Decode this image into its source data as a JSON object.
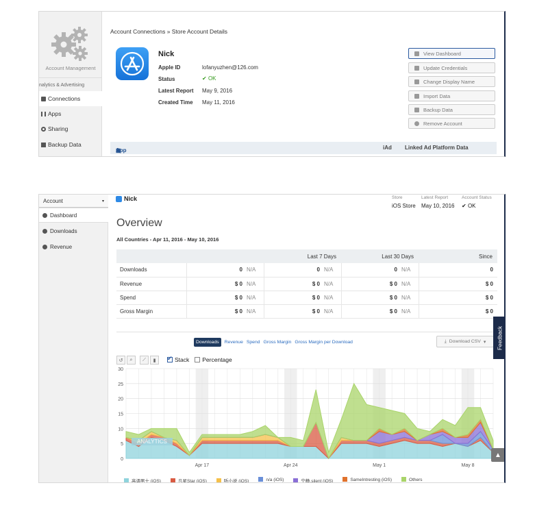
{
  "top_panel": {
    "sidebar": {
      "account_management": "Account Management",
      "section_label": "nalytics & Advertising",
      "items": [
        {
          "label": "Connections",
          "active": true
        },
        {
          "label": "Apps"
        },
        {
          "label": "Sharing"
        },
        {
          "label": "Backup Data"
        }
      ]
    },
    "breadcrumb": "Account Connections » Store Account Details",
    "account": {
      "name": "Nick",
      "fields": [
        {
          "label": "Apple ID",
          "value": "lofanyuzhen@126.com"
        },
        {
          "label": "Status",
          "value": "OK"
        },
        {
          "label": "Latest Report",
          "value": "May 9, 2016"
        },
        {
          "label": "Created Time",
          "value": "May 11, 2016"
        }
      ]
    },
    "actions": [
      "View Dashboard",
      "Update Credentials",
      "Change Display Name",
      "Import Data",
      "Backup Data",
      "Remove Account"
    ],
    "table_header": {
      "app": "App",
      "iad": "iAd",
      "linked": "Linked Ad Platform Data"
    }
  },
  "bottom_panel": {
    "sidebar": {
      "account_dropdown": "Account",
      "items": [
        {
          "label": "Dashboard",
          "active": true
        },
        {
          "label": "Downloads"
        },
        {
          "label": "Revenue"
        }
      ]
    },
    "header": {
      "name": "Nick",
      "store_label": "Store",
      "store_value": "iOS Store",
      "latest_report_label": "Latest Report",
      "latest_report_value": "May 10, 2016",
      "status_label": "Account Status",
      "status_value": "OK"
    },
    "overview": {
      "title": "Overview",
      "subtitle": "All Countries - Apr 11, 2016 - May 10, 2016",
      "columns": [
        "Last 7 Days",
        "Last 30 Days",
        "Since"
      ],
      "rows": [
        {
          "label": "Downloads",
          "c1": "0",
          "c1na": "N/A",
          "c2": "0",
          "c2na": "N/A",
          "c3": "0",
          "c3na": "N/A",
          "since": "0"
        },
        {
          "label": "Revenue",
          "c1": "$ 0",
          "c1na": "N/A",
          "c2": "$ 0",
          "c2na": "N/A",
          "c3": "$ 0",
          "c3na": "N/A",
          "since": "$ 0"
        },
        {
          "label": "Spend",
          "c1": "$ 0",
          "c1na": "N/A",
          "c2": "$ 0",
          "c2na": "N/A",
          "c3": "$ 0",
          "c3na": "N/A",
          "since": "$ 0"
        },
        {
          "label": "Gross Margin",
          "c1": "$ 0",
          "c1na": "N/A",
          "c2": "$ 0",
          "c2na": "N/A",
          "c3": "$ 0",
          "c3na": "N/A",
          "since": "$ 0"
        }
      ]
    },
    "chart_tabs": [
      "Downloads",
      "Revenue",
      "Spend",
      "Gross Margin",
      "Gross Margin per Download"
    ],
    "download_csv": "Download CSV",
    "feedback": "Feedback",
    "options": {
      "stack": "Stack",
      "percentage": "Percentage"
    },
    "watermark": "ANALYTICS"
  },
  "chart_data": {
    "type": "area",
    "stacked": true,
    "ylim": [
      0,
      30
    ],
    "yticks": [
      0,
      5,
      10,
      15,
      20,
      25,
      30
    ],
    "xtick_labels": [
      "Apr 17",
      "Apr 24",
      "May 1",
      "May 8"
    ],
    "x": [
      "Apr 11",
      "Apr 12",
      "Apr 13",
      "Apr 14",
      "Apr 15",
      "Apr 16",
      "Apr 17",
      "Apr 18",
      "Apr 19",
      "Apr 20",
      "Apr 21",
      "Apr 22",
      "Apr 23",
      "Apr 24",
      "Apr 25",
      "Apr 26",
      "Apr 27",
      "Apr 28",
      "Apr 29",
      "Apr 30",
      "May 1",
      "May 2",
      "May 3",
      "May 4",
      "May 5",
      "May 6",
      "May 7",
      "May 8",
      "May 9",
      "May 10"
    ],
    "series": [
      {
        "name": "高调男士 (iOS)",
        "color": "#8fd3dc",
        "values": [
          6,
          4,
          7,
          6,
          4,
          1,
          5,
          5,
          5,
          5,
          5,
          5,
          5,
          4,
          4,
          4,
          0,
          5,
          5,
          5,
          4,
          5,
          6,
          5,
          5,
          4,
          5,
          4,
          6,
          2
        ]
      },
      {
        "name": "凡星Star (iOS)",
        "color": "#d95b43",
        "values": [
          1,
          1,
          1,
          1,
          1,
          0,
          1,
          1,
          1,
          1,
          1,
          1,
          1,
          0,
          0,
          8,
          0,
          1,
          1,
          1,
          1,
          1,
          1,
          1,
          1,
          1,
          0,
          0,
          1,
          0
        ]
      },
      {
        "name": "听小说 (iOS)",
        "color": "#f5c04a",
        "values": [
          0,
          1,
          1,
          0,
          1,
          0,
          1,
          1,
          1,
          1,
          1,
          2,
          1,
          0,
          0,
          0,
          0,
          1,
          0,
          0,
          0,
          0,
          0,
          0,
          0,
          0,
          0,
          0,
          0,
          0
        ]
      },
      {
        "name": "n/a (iOS)",
        "color": "#6a8fd8",
        "values": [
          0,
          0,
          0,
          0,
          0,
          0,
          0,
          0,
          0,
          0,
          0,
          0,
          0,
          0,
          0,
          0,
          0,
          0,
          0,
          0,
          0,
          0,
          0,
          0,
          0,
          3,
          0,
          1,
          2,
          1
        ]
      },
      {
        "name": "宁静.silent (iOS)",
        "color": "#8a6fd6",
        "values": [
          0,
          0,
          0,
          0,
          0,
          0,
          0,
          0,
          0,
          0,
          0,
          0,
          0,
          0,
          0,
          0,
          0,
          0,
          0,
          0,
          4,
          2,
          2,
          0,
          2,
          1,
          2,
          2,
          3,
          0
        ]
      },
      {
        "name": "SameIntresting (iOS)",
        "color": "#e0722d",
        "values": [
          0,
          0,
          0,
          0,
          0,
          0,
          0,
          0,
          0,
          0,
          0,
          0,
          0,
          0,
          0,
          0,
          0,
          0,
          0,
          0,
          1,
          0,
          1,
          0,
          0,
          1,
          0,
          1,
          1,
          0
        ]
      },
      {
        "name": "Others",
        "color": "#a9d46a",
        "values": [
          2,
          2,
          1,
          3,
          4,
          1,
          1,
          1,
          1,
          1,
          2,
          3,
          0,
          3,
          2,
          11,
          2,
          6,
          19,
          12,
          7,
          8,
          5,
          4,
          1,
          3,
          4,
          9,
          4,
          3
        ]
      }
    ]
  }
}
